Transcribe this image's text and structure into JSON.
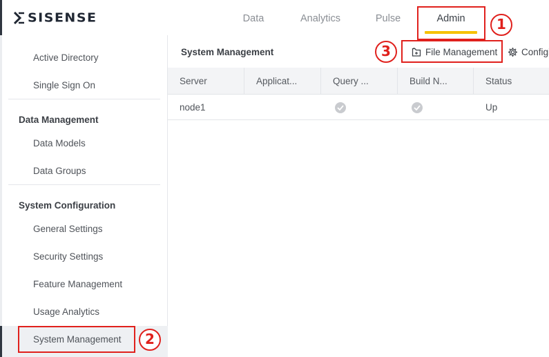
{
  "app": {
    "logo_text": "SISENSE"
  },
  "nav": {
    "tabs": [
      {
        "label": "Data",
        "active": false
      },
      {
        "label": "Analytics",
        "active": false
      },
      {
        "label": "Pulse",
        "active": false
      },
      {
        "label": "Admin",
        "active": true
      }
    ],
    "active_underline_color": "#f6c100"
  },
  "sidebar": {
    "items_top": [
      {
        "label": "Active Directory"
      },
      {
        "label": "Single Sign On"
      }
    ],
    "sections": [
      {
        "heading": "Data Management",
        "items": [
          {
            "label": "Data Models"
          },
          {
            "label": "Data Groups"
          }
        ]
      },
      {
        "heading": "System Configuration",
        "items": [
          {
            "label": "General Settings"
          },
          {
            "label": "Security Settings"
          },
          {
            "label": "Feature Management"
          },
          {
            "label": "Usage Analytics"
          },
          {
            "label": "System Management"
          }
        ]
      }
    ],
    "active_item": "System Management"
  },
  "main": {
    "title": "System Management",
    "toolbar": {
      "file_management_label": "File Management",
      "configuration_label": "Configi"
    },
    "table": {
      "columns": [
        "Server",
        "Applicat...",
        "Query ...",
        "Build N...",
        "Status"
      ],
      "rows": [
        {
          "server": "node1",
          "application": "",
          "query": "check",
          "build": "check",
          "status": "Up"
        }
      ]
    }
  },
  "annotations": {
    "color": "#e0201c",
    "labels": [
      "1",
      "2",
      "3"
    ]
  }
}
